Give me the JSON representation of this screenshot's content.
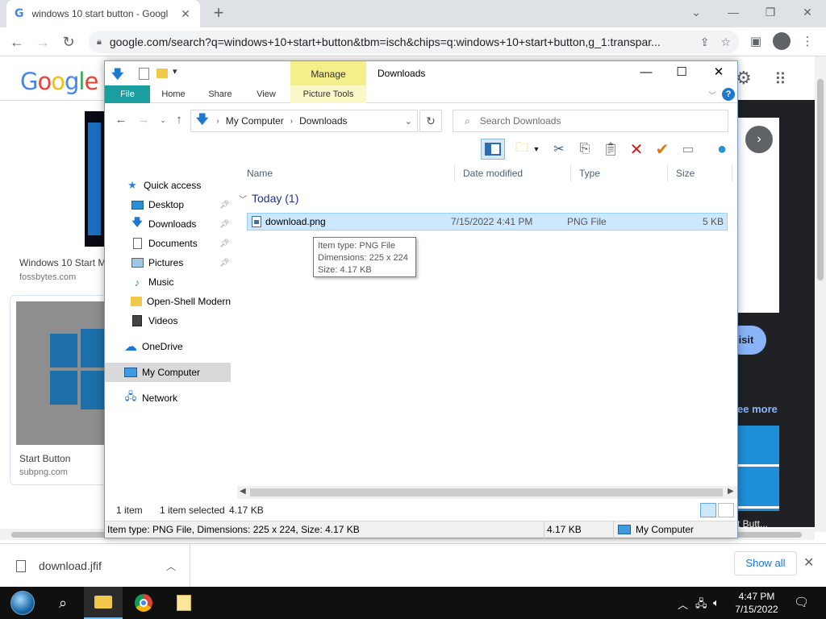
{
  "browser": {
    "tab_title": "windows 10 start button - Googl",
    "tab_favicon": "G",
    "url": "google.com/search?q=windows+10+start+button&tbm=isch&chips=q:windows+10+start+button,g_1:transpar...",
    "icons": [
      "back-icon",
      "forward-icon",
      "reload-icon",
      "lock-icon",
      "share-icon",
      "star-icon",
      "sidebar-icon",
      "profile-icon",
      "menu-icon"
    ]
  },
  "google": {
    "logo": [
      "G",
      "o",
      "o",
      "g",
      "l",
      "e"
    ],
    "logo_colors": [
      "#4285f4",
      "#ea4335",
      "#fbbc05",
      "#4285f4",
      "#34a853",
      "#ea4335"
    ],
    "results": [
      {
        "title": "Windows 10 Start M",
        "source": "fossbytes.com"
      },
      {
        "title": "Start Button",
        "source": "subpng.com"
      }
    ],
    "panel_visit": "isit",
    "panel_see_more": "ee more",
    "panel_caption": "t Butt..."
  },
  "explorer": {
    "title": "Downloads",
    "manage_tab": "Manage",
    "ribbon_tabs": {
      "file": "File",
      "home": "Home",
      "share": "Share",
      "view": "View",
      "picture_tools": "Picture Tools"
    },
    "address": {
      "root": "My Computer",
      "current": "Downloads"
    },
    "search_placeholder": "Search Downloads",
    "nav": {
      "quick_access": "Quick access",
      "desktop": "Desktop",
      "downloads": "Downloads",
      "documents": "Documents",
      "pictures": "Pictures",
      "music": "Music",
      "open_shell": "Open-Shell Modern",
      "videos": "Videos",
      "onedrive": "OneDrive",
      "my_computer": "My Computer",
      "network": "Network"
    },
    "columns": {
      "name": "Name",
      "date": "Date modified",
      "type": "Type",
      "size": "Size"
    },
    "group": "Today (1)",
    "file": {
      "name": "download.png",
      "date": "7/15/2022 4:41 PM",
      "type": "PNG File",
      "size": "5 KB"
    },
    "tooltip": {
      "type": "Item type: PNG File",
      "dimensions": "Dimensions: 225 x 224",
      "size": "Size: 4.17 KB"
    },
    "status": {
      "count": "1 item",
      "selected": "1 item selected",
      "selected_size": "4.17 KB"
    },
    "details": {
      "info": "Item type: PNG File, Dimensions: 225 x 224, Size: 4.17 KB",
      "size": "4.17 KB",
      "location": "My Computer"
    },
    "colors": {
      "file_tab": "#1a9ea0",
      "manage": "#f4ee8b",
      "selection": "#cce8ff"
    }
  },
  "download_bar": {
    "filename": "download.jfif",
    "show_all": "Show all"
  },
  "taskbar": {
    "time": "4:47 PM",
    "date": "7/15/2022"
  }
}
